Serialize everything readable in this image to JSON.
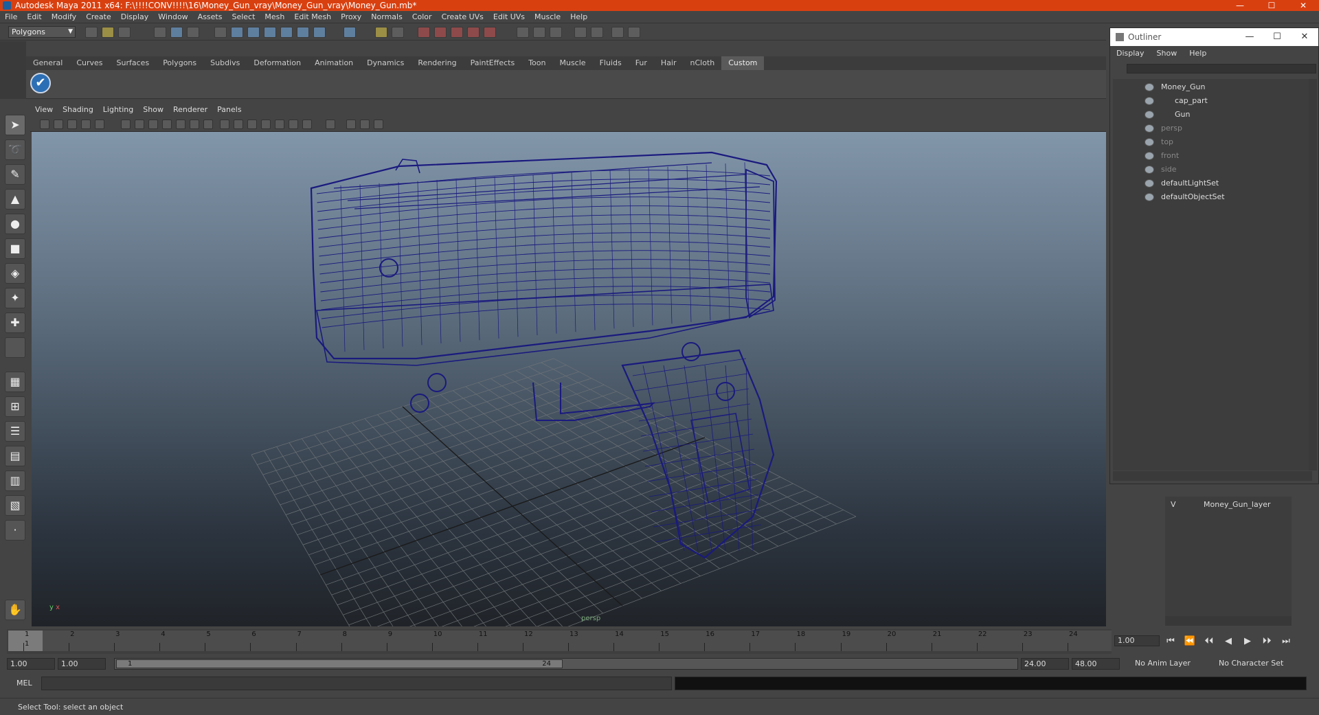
{
  "window": {
    "title": "Autodesk Maya 2011 x64: F:\\!!!!CONV!!!!\\16\\Money_Gun_vray\\Money_Gun_vray\\Money_Gun.mb*",
    "min": "—",
    "max": "☐",
    "close": "✕"
  },
  "menubar": [
    "File",
    "Edit",
    "Modify",
    "Create",
    "Display",
    "Window",
    "Assets",
    "Select",
    "Mesh",
    "Edit Mesh",
    "Proxy",
    "Normals",
    "Color",
    "Create UVs",
    "Edit UVs",
    "Muscle",
    "Help"
  ],
  "statusline": {
    "mode": "Polygons"
  },
  "shelf": {
    "tabs": [
      "General",
      "Curves",
      "Surfaces",
      "Polygons",
      "Subdivs",
      "Deformation",
      "Animation",
      "Dynamics",
      "Rendering",
      "PaintEffects",
      "Toon",
      "Muscle",
      "Fluids",
      "Fur",
      "Hair",
      "nCloth",
      "Custom"
    ],
    "active_tab": "Custom",
    "button_icon": "check-icon"
  },
  "panel": {
    "menu": [
      "View",
      "Shading",
      "Lighting",
      "Show",
      "Renderer",
      "Panels"
    ],
    "axis_label": "y",
    "axis_label2": "x",
    "camera_label": "persp"
  },
  "outliner": {
    "title": "Outliner",
    "menu": [
      "Display",
      "Show",
      "Help"
    ],
    "items": [
      {
        "label": "Money_Gun",
        "dim": false,
        "indent": 0
      },
      {
        "label": "cap_part",
        "dim": false,
        "indent": 1
      },
      {
        "label": "Gun",
        "dim": false,
        "indent": 1
      },
      {
        "label": "persp",
        "dim": true,
        "indent": 0
      },
      {
        "label": "top",
        "dim": true,
        "indent": 0
      },
      {
        "label": "front",
        "dim": true,
        "indent": 0
      },
      {
        "label": "side",
        "dim": true,
        "indent": 0
      },
      {
        "label": "defaultLightSet",
        "dim": false,
        "indent": 0
      },
      {
        "label": "defaultObjectSet",
        "dim": false,
        "indent": 0
      }
    ]
  },
  "layers": {
    "visible": "V",
    "name": "Money_Gun_layer"
  },
  "timeslider": {
    "ticks": [
      "1",
      "2",
      "3",
      "4",
      "5",
      "6",
      "7",
      "8",
      "9",
      "10",
      "11",
      "12",
      "13",
      "14",
      "15",
      "16",
      "17",
      "18",
      "19",
      "20",
      "21",
      "22",
      "23",
      "24"
    ],
    "current_frame": "1",
    "current_field": "1.00"
  },
  "playback_controls": [
    "⏮",
    "⏪",
    "⏴⏴",
    "◀",
    "▶",
    "⏵⏵",
    "⏭"
  ],
  "range": {
    "start": "1.00",
    "anim_start": "1.00",
    "slider_start": "1",
    "slider_end": "24",
    "anim_end": "24.00",
    "end": "48.00",
    "anim_layer": "No Anim Layer",
    "character_set": "No Character Set"
  },
  "mel": {
    "label": "MEL"
  },
  "help": {
    "text": "Select Tool: select an object"
  },
  "colors": {
    "titlebar": "#d94010",
    "wireframe": "#1a1a7e",
    "ui_bg": "#444444"
  }
}
